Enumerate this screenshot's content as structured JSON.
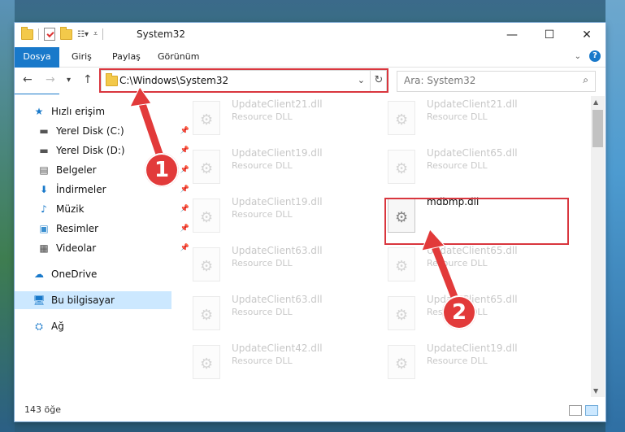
{
  "window": {
    "title": "System32"
  },
  "ribbon": {
    "tabs": [
      "Dosya",
      "Giriş",
      "Paylaş",
      "Görünüm"
    ],
    "help": "?"
  },
  "nav": {
    "back": "←",
    "forward": "→",
    "recent": "▾",
    "up": "↑"
  },
  "address": {
    "path": "C:\\Windows\\System32",
    "chevron": "⌄",
    "refresh": "↻"
  },
  "search": {
    "placeholder": "Ara: System32",
    "icon": "⌕"
  },
  "sidebar": {
    "items": [
      {
        "label": "Hızlı erişim",
        "icon": "star-icon",
        "pinned": false
      },
      {
        "label": "Yerel Disk (C:)",
        "icon": "drive-icon",
        "pinned": true
      },
      {
        "label": "Yerel Disk (D:)",
        "icon": "drive-icon",
        "pinned": true
      },
      {
        "label": "Belgeler",
        "icon": "document-icon",
        "pinned": true
      },
      {
        "label": "İndirmeler",
        "icon": "download-icon",
        "pinned": true
      },
      {
        "label": "Müzik",
        "icon": "music-icon",
        "pinned": true
      },
      {
        "label": "Resimler",
        "icon": "pictures-icon",
        "pinned": true
      },
      {
        "label": "Videolar",
        "icon": "video-icon",
        "pinned": true
      },
      {
        "label": "OneDrive",
        "icon": "cloud-icon",
        "pinned": false
      },
      {
        "label": "Bu bilgisayar",
        "icon": "computer-icon",
        "pinned": false
      },
      {
        "label": "Ağ",
        "icon": "network-icon",
        "pinned": false
      }
    ]
  },
  "files": {
    "left": [
      {
        "name": "UpdateClient21.dll",
        "desc": "Resource DLL"
      },
      {
        "name": "UpdateClient19.dll",
        "desc": "Resource DLL"
      },
      {
        "name": "UpdateClient19.dll",
        "desc": "Resource DLL"
      },
      {
        "name": "UpdateClient63.dll",
        "desc": "Resource DLL"
      },
      {
        "name": "UpdateClient63.dll",
        "desc": "Resource DLL"
      },
      {
        "name": "UpdateClient42.dll",
        "desc": "Resource DLL"
      }
    ],
    "right": [
      {
        "name": "UpdateClient21.dll",
        "desc": "Resource DLL"
      },
      {
        "name": "UpdateClient65.dll",
        "desc": "Resource DLL"
      },
      {
        "name": "mdbmp.dll",
        "desc": ""
      },
      {
        "name": "UpdateClient65.dll",
        "desc": "Resource DLL"
      },
      {
        "name": "UpdateClient65.dll",
        "desc": "Resource DLL"
      },
      {
        "name": "UpdateClient19.dll",
        "desc": "Resource DLL"
      }
    ]
  },
  "status": {
    "count": "143 öğe"
  },
  "callouts": {
    "one": "1",
    "two": "2"
  },
  "colors": {
    "accent": "#1979ca",
    "highlight": "#d9363e",
    "selected": "#cce8ff"
  }
}
